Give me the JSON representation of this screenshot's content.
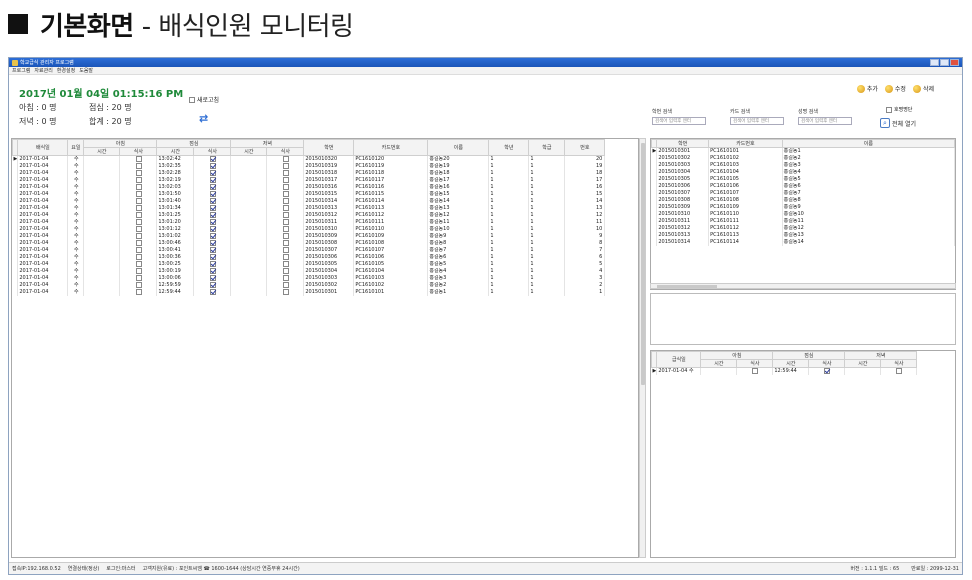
{
  "headline": {
    "prefix": "기본화면",
    "suffix": "- 배식인원 모니터링"
  },
  "window": {
    "title": "학교급식 관리자 프로그램",
    "menu": [
      "프로그램",
      "자료관리",
      "환경설정",
      "도움말"
    ]
  },
  "header": {
    "datetime": "2017년 01월 04일 01:15:16 PM",
    "stats": {
      "breakfast": "아침 : 0 명",
      "lunch": "점심 : 20 명",
      "dinner": "저녁 : 0 명",
      "total": "합계 : 20 명"
    },
    "refresh_label": "새로고침"
  },
  "toolbar": {
    "add": "추가",
    "edit": "수정",
    "delete": "삭제"
  },
  "search": {
    "student_no_label": "학번 검색",
    "card_label": "카드 검색",
    "name_label": "성명 검색",
    "placeholder": "검색어 입력후 엔터",
    "name_exists_label": "호명명단",
    "view_all_label": "전체 열기"
  },
  "main_grid": {
    "group_headers": [
      "아침",
      "점심",
      "저녁"
    ],
    "headers": [
      "배식일",
      "요일",
      "시간",
      "식사",
      "시간",
      "식사",
      "시간",
      "식사",
      "학번",
      "카드번호",
      "이름",
      "학년",
      "학급",
      "번호"
    ],
    "rows": [
      [
        "2017-01-04",
        "수",
        "13:02:42",
        "2015010320",
        "PC1610120",
        "홍길동20",
        "1",
        "1",
        "20"
      ],
      [
        "2017-01-04",
        "수",
        "13:02:35",
        "2015010319",
        "PC1610119",
        "홍길동19",
        "1",
        "1",
        "19"
      ],
      [
        "2017-01-04",
        "수",
        "13:02:28",
        "2015010318",
        "PC1610118",
        "홍길동18",
        "1",
        "1",
        "18"
      ],
      [
        "2017-01-04",
        "수",
        "13:02:19",
        "2015010317",
        "PC1610117",
        "홍길동17",
        "1",
        "1",
        "17"
      ],
      [
        "2017-01-04",
        "수",
        "13:02:03",
        "2015010316",
        "PC1610116",
        "홍길동16",
        "1",
        "1",
        "16"
      ],
      [
        "2017-01-04",
        "수",
        "13:01:50",
        "2015010315",
        "PC1610115",
        "홍길동15",
        "1",
        "1",
        "15"
      ],
      [
        "2017-01-04",
        "수",
        "13:01:40",
        "2015010314",
        "PC1610114",
        "홍길동14",
        "1",
        "1",
        "14"
      ],
      [
        "2017-01-04",
        "수",
        "13:01:34",
        "2015010313",
        "PC1610113",
        "홍길동13",
        "1",
        "1",
        "13"
      ],
      [
        "2017-01-04",
        "수",
        "13:01:25",
        "2015010312",
        "PC1610112",
        "홍길동12",
        "1",
        "1",
        "12"
      ],
      [
        "2017-01-04",
        "수",
        "13:01:20",
        "2015010311",
        "PC1610111",
        "홍길동11",
        "1",
        "1",
        "11"
      ],
      [
        "2017-01-04",
        "수",
        "13:01:12",
        "2015010310",
        "PC1610110",
        "홍길동10",
        "1",
        "1",
        "10"
      ],
      [
        "2017-01-04",
        "수",
        "13:01:02",
        "2015010309",
        "PC1610109",
        "홍길동9",
        "1",
        "1",
        "9"
      ],
      [
        "2017-01-04",
        "수",
        "13:00:46",
        "2015010308",
        "PC1610108",
        "홍길동8",
        "1",
        "1",
        "8"
      ],
      [
        "2017-01-04",
        "수",
        "13:00:41",
        "2015010307",
        "PC1610107",
        "홍길동7",
        "1",
        "1",
        "7"
      ],
      [
        "2017-01-04",
        "수",
        "13:00:36",
        "2015010306",
        "PC1610106",
        "홍길동6",
        "1",
        "1",
        "6"
      ],
      [
        "2017-01-04",
        "수",
        "13:00:25",
        "2015010305",
        "PC1610105",
        "홍길동5",
        "1",
        "1",
        "5"
      ],
      [
        "2017-01-04",
        "수",
        "13:00:19",
        "2015010304",
        "PC1610104",
        "홍길동4",
        "1",
        "1",
        "4"
      ],
      [
        "2017-01-04",
        "수",
        "13:00:06",
        "2015010303",
        "PC1610103",
        "홍길동3",
        "1",
        "1",
        "3"
      ],
      [
        "2017-01-04",
        "수",
        "12:59:59",
        "2015010302",
        "PC1610102",
        "홍길동2",
        "1",
        "1",
        "2"
      ],
      [
        "2017-01-04",
        "수",
        "12:59:44",
        "2015010301",
        "PC1610101",
        "홍길동1",
        "1",
        "1",
        "1"
      ]
    ]
  },
  "student_grid": {
    "headers": [
      "학번",
      "카드번호",
      "이름"
    ],
    "rows": [
      [
        "2015010301",
        "PC1610101",
        "홍길동1"
      ],
      [
        "2015010302",
        "PC1610102",
        "홍길동2"
      ],
      [
        "2015010303",
        "PC1610103",
        "홍길동3"
      ],
      [
        "2015010304",
        "PC1610104",
        "홍길동4"
      ],
      [
        "2015010305",
        "PC1610105",
        "홍길동5"
      ],
      [
        "2015010306",
        "PC1610106",
        "홍길동6"
      ],
      [
        "2015010307",
        "PC1610107",
        "홍길동7"
      ],
      [
        "2015010308",
        "PC1610108",
        "홍길동8"
      ],
      [
        "2015010309",
        "PC1610109",
        "홍길동9"
      ],
      [
        "2015010310",
        "PC1610110",
        "홍길동10"
      ],
      [
        "2015010311",
        "PC1610111",
        "홍길동11"
      ],
      [
        "2015010312",
        "PC1610112",
        "홍길동12"
      ],
      [
        "2015010313",
        "PC1610113",
        "홍길동13"
      ],
      [
        "2015010314",
        "PC1610114",
        "홍길동14"
      ]
    ]
  },
  "history_grid": {
    "group_headers": [
      "아침",
      "점심",
      "저녁"
    ],
    "headers": [
      "급식일",
      "시간",
      "식사",
      "시간",
      "식사",
      "시간",
      "식사"
    ],
    "rows": [
      [
        "2017-01-04 수",
        "",
        "",
        "12:59:44",
        "",
        "",
        ""
      ]
    ]
  },
  "statusbar": {
    "ip": "접속IP:192.168.0.52",
    "conn": "연결상태(정상)",
    "login": "로그인:마스터",
    "support": "고객지원(유료) : 포인트씨엠 ☎ 1600-1644 (상담시간 연중무휴 24시간)",
    "version": "버전 : 1.1.1 빌드 : 65",
    "expiry": "만료일 : 2099-12-31"
  },
  "colors": {
    "datetime": "#1f8a3a",
    "titlebar": "#1b55b8",
    "accent": "#2b6cd4"
  }
}
